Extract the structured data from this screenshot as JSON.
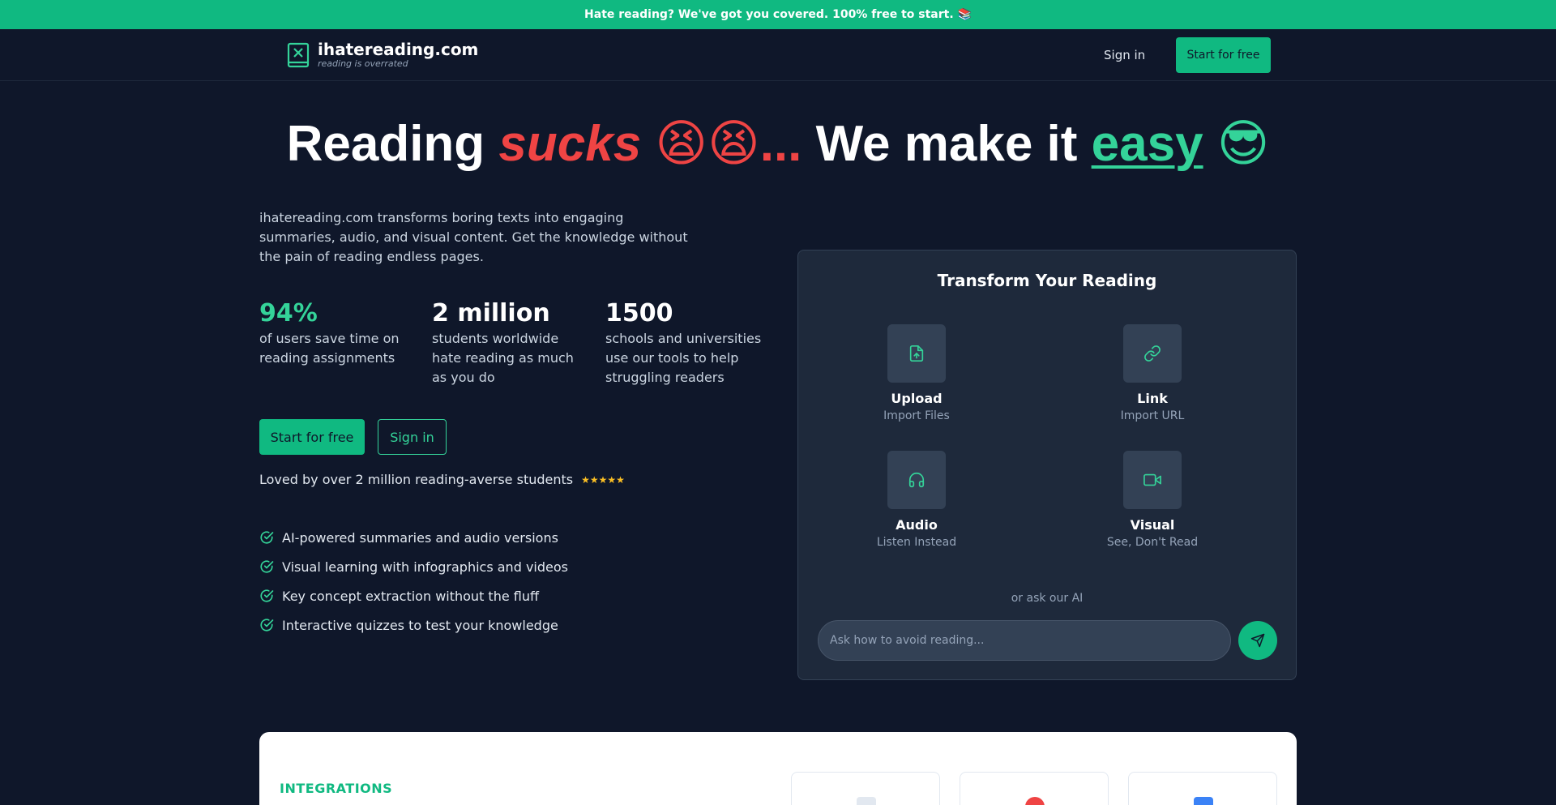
{
  "banner": {
    "text": "Hate reading? We've got you covered. 100% free to start. 📚"
  },
  "nav": {
    "brand": "ihatereading.com",
    "tagline": "reading is overrated",
    "signin": "Sign in",
    "start": "Start for free"
  },
  "hero": {
    "title_a": "Reading ",
    "title_sucks": "sucks",
    "title_emoji": " 😫😫",
    "title_dots": "...",
    "title_b": " We make it ",
    "title_easy": "easy",
    "title_emoji2": " 😎"
  },
  "intro": "ihatereading.com transforms boring texts into engaging summaries, audio, and visual content. Get the knowledge without the pain of reading endless pages.",
  "stats": [
    {
      "value": "94%",
      "label": "of users save time on reading assignments"
    },
    {
      "value": "2 million",
      "label": "students worldwide hate reading as much as you do"
    },
    {
      "value": "1500",
      "label": "schools and universities use our tools to help struggling readers"
    }
  ],
  "cta": {
    "start": "Start for free",
    "signin": "Sign in"
  },
  "loved": {
    "text": "Loved by over 2 million reading-averse students",
    "stars": "★★★★★"
  },
  "features": [
    "AI-powered summaries and audio versions",
    "Visual learning with infographics and videos",
    "Key concept extraction without the fluff",
    "Interactive quizzes to test your knowledge"
  ],
  "card": {
    "title": "Transform Your Reading",
    "tiles": [
      {
        "title": "Upload",
        "sub": "Import Files",
        "icon": "file-upload-icon"
      },
      {
        "title": "Link",
        "sub": "Import URL",
        "icon": "link-icon"
      },
      {
        "title": "Audio",
        "sub": "Listen Instead",
        "icon": "headphones-icon"
      },
      {
        "title": "Visual",
        "sub": "See, Don't Read",
        "icon": "video-icon"
      }
    ],
    "or_ask": "or ask our AI",
    "placeholder": "Ask how to avoid reading..."
  },
  "integrations": {
    "label": "INTEGRATIONS"
  },
  "colors": {
    "accent": "#10b981",
    "accent_light": "#34d399",
    "danger": "#ef4444",
    "bg": "#0f172a",
    "card": "#1e293b"
  }
}
